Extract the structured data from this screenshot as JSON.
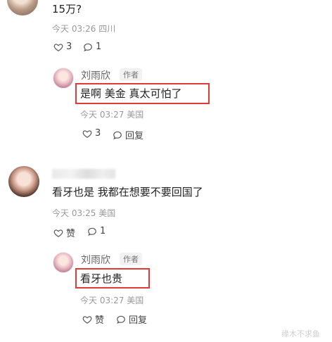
{
  "comment1": {
    "text": "15万?",
    "time": "今天 03:26 四川",
    "likes": "3",
    "replies": "1",
    "reply": {
      "author": "刘雨欣",
      "tag": "作者",
      "text": "是啊 美金 真太可怕了",
      "time": "今天 03:27 美国",
      "likes": "3",
      "reply_label": "回复"
    }
  },
  "comment2": {
    "text": "看牙也是 我都在想要不要回国了",
    "time": "今天 03:25 美国",
    "like_label": "赞",
    "replies": "1",
    "reply": {
      "author": "刘雨欣",
      "tag": "作者",
      "text": "看牙也贵",
      "time": "今天 03:27 美国",
      "like_label": "赞",
      "reply_label": "回复"
    }
  },
  "watermark": "缘木不求鱼",
  "colors": {
    "highlight": "#e53935",
    "meta": "#999999",
    "text": "#222222"
  }
}
